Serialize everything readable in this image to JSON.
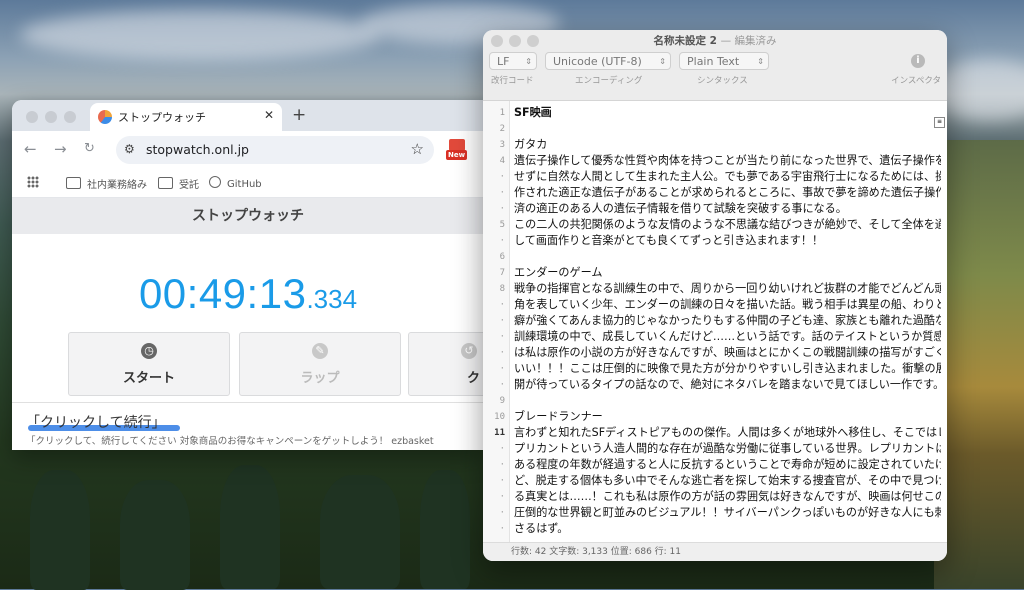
{
  "browser": {
    "tab_title": "ストップウォッチ",
    "url": "stopwatch.onl.jp",
    "bookmarks": [
      {
        "label": "社内業務絡み"
      },
      {
        "label": "受託"
      },
      {
        "label": "GitHub"
      }
    ],
    "ext_badge": "New",
    "page": {
      "header": "ストップウォッチ",
      "time_main": "00:49:13",
      "time_ms": ".334",
      "buttons": {
        "start": "スタート",
        "lap": "ラップ",
        "clear": "ク"
      },
      "ad_title": "「クリックして続行」",
      "ad_text": "「クリックして、続行してください 対象商品のお得なキャンペーンをゲットしよう！ ezbasket"
    },
    "colors": {
      "time": "#1a9be8",
      "ad_underline": "#4d8ee8"
    }
  },
  "editor": {
    "title": "名称未設定 2",
    "title_suffix": "— 編集済み",
    "line_ending": "LF",
    "line_ending_caption": "改行コード",
    "encoding": "Unicode (UTF-8)",
    "encoding_caption": "エンコーディング",
    "syntax": "Plain Text",
    "syntax_caption": "シンタックス",
    "inspector_caption": "インスペクタ",
    "gutter": [
      "1",
      "",
      "2",
      "",
      "3",
      "4",
      "·",
      "·",
      "·",
      "5",
      "·",
      "",
      "6",
      "",
      "7",
      "8",
      "·",
      "·",
      "·",
      "·",
      "·",
      "·",
      "",
      "9",
      "",
      "10",
      "11",
      "·",
      "·",
      "·",
      "·",
      "·",
      "·",
      "·",
      "·"
    ],
    "lines": [
      "SF映画",
      "",
      "ガタカ",
      "遺伝子操作して優秀な性質や肉体を持つことが当たり前になった世界で、遺伝子操作を",
      "せずに自然な人間として生まれた主人公。でも夢である宇宙飛行士になるためには、操",
      "作された適正な遺伝子があることが求められるところに、事故で夢を諦めた遺伝子操作",
      "済の適正のある人の遺伝子情報を借りて試験を突破する事になる。",
      "この二人の共犯関係のような友情のような不思議な結びつきが絶妙で、そして全体を通",
      "して画面作りと音楽がとても良くてずっと引き込まれます！！",
      "",
      "エンダーのゲーム",
      "戦争の指揮官となる訓練生の中で、周りから一回り幼いけれど抜群の才能でどんどん頭",
      "角を表していく少年、エンダーの訓練の日々を描いた話。戦う相手は異星の船、わりと",
      "癖が強くてあんま協力的じゃなかったりもする仲間の子ども達、家族とも離れた過酷な",
      "訓練環境の中で、成長していくんだけど……という話です。話のテイストというか質感",
      "は私は原作の小説の方が好きなんですが、映画はとにかくこの戦闘訓練の描写がすごく",
      "いい！！！ここは圧倒的に映像で見た方が分かりやすいし引き込まれました。衝撃の展",
      "開が待っているタイプの話なので、絶対にネタバレを踏まないで見てほしい一作です。",
      "",
      "ブレードランナー",
      "言わずと知れたSFディストピアものの傑作。人間は多くが地球外へ移住し、そこではレ",
      "プリカントという人造人間的な存在が過酷な労働に従事している世界。レプリカントは",
      "ある程度の年数が経過すると人に反抗するということで寿命が短めに設定されていたけ",
      "ど、脱走する個体も多い中でそんな逃亡者を探して始末する捜査官が、その中で見つけ",
      "る真実とは……！これも私は原作の方が話の雰囲気は好きなんですが、映画は何せこの",
      "圧倒的な世界観と町並みのビジュアル！！サイバーパンクっぽいものが好きな人にも刺",
      "さるはず。"
    ],
    "status": "行数: 42   文字数: 3,133   位置: 686   行: 11"
  }
}
